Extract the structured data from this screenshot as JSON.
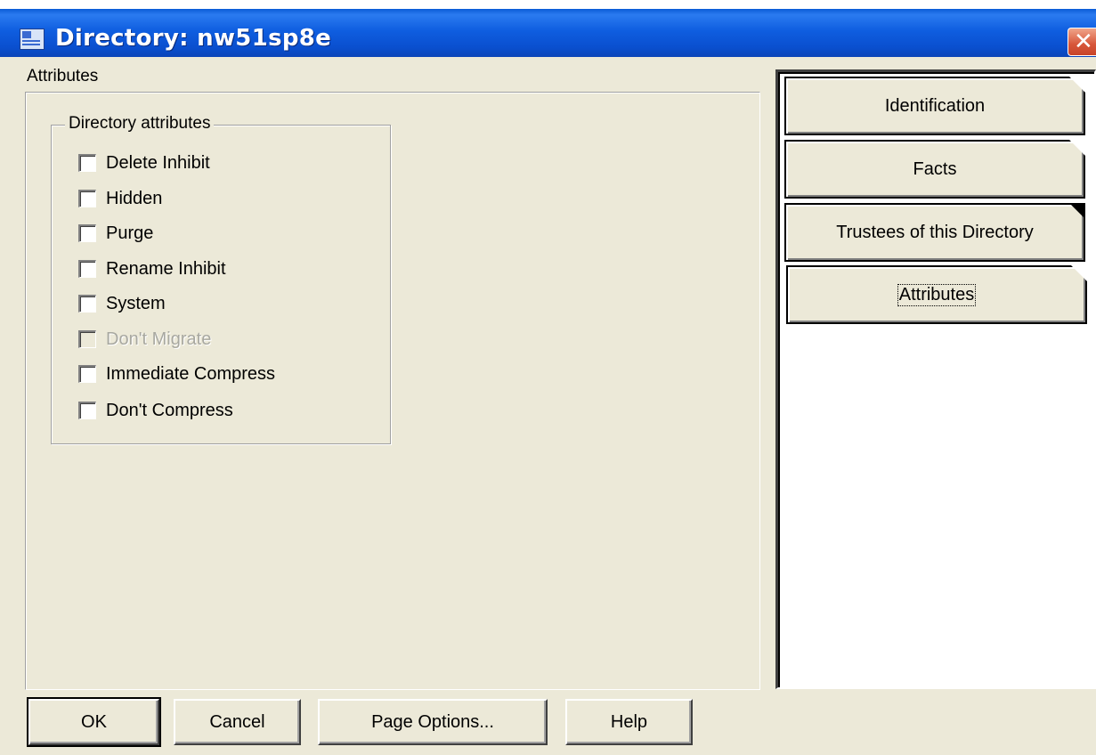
{
  "window": {
    "title": "Directory: nw51sp8e",
    "close_icon": "close-icon"
  },
  "content": {
    "section_label": "Attributes",
    "group_title": "Directory attributes",
    "checkboxes": [
      {
        "label": "Delete Inhibit",
        "checked": false,
        "enabled": true
      },
      {
        "label": "Hidden",
        "checked": false,
        "enabled": true
      },
      {
        "label": "Purge",
        "checked": false,
        "enabled": true
      },
      {
        "label": "Rename Inhibit",
        "checked": false,
        "enabled": true
      },
      {
        "label": "System",
        "checked": false,
        "enabled": true
      },
      {
        "label": "Don't Migrate",
        "checked": false,
        "enabled": false
      },
      {
        "label": "Immediate Compress",
        "checked": false,
        "enabled": true
      },
      {
        "label": "Don't Compress",
        "checked": false,
        "enabled": true
      }
    ]
  },
  "tabs": [
    {
      "label": "Identification",
      "active": false
    },
    {
      "label": "Facts",
      "active": false
    },
    {
      "label": "Trustees of this Directory",
      "active": false
    },
    {
      "label": "Attributes",
      "active": true
    }
  ],
  "buttons": {
    "ok": "OK",
    "cancel": "Cancel",
    "page_options": "Page Options...",
    "help": "Help"
  },
  "colors": {
    "titlebar": "#0a5bd6",
    "face": "#ece9d8",
    "close": "#d7563a"
  }
}
